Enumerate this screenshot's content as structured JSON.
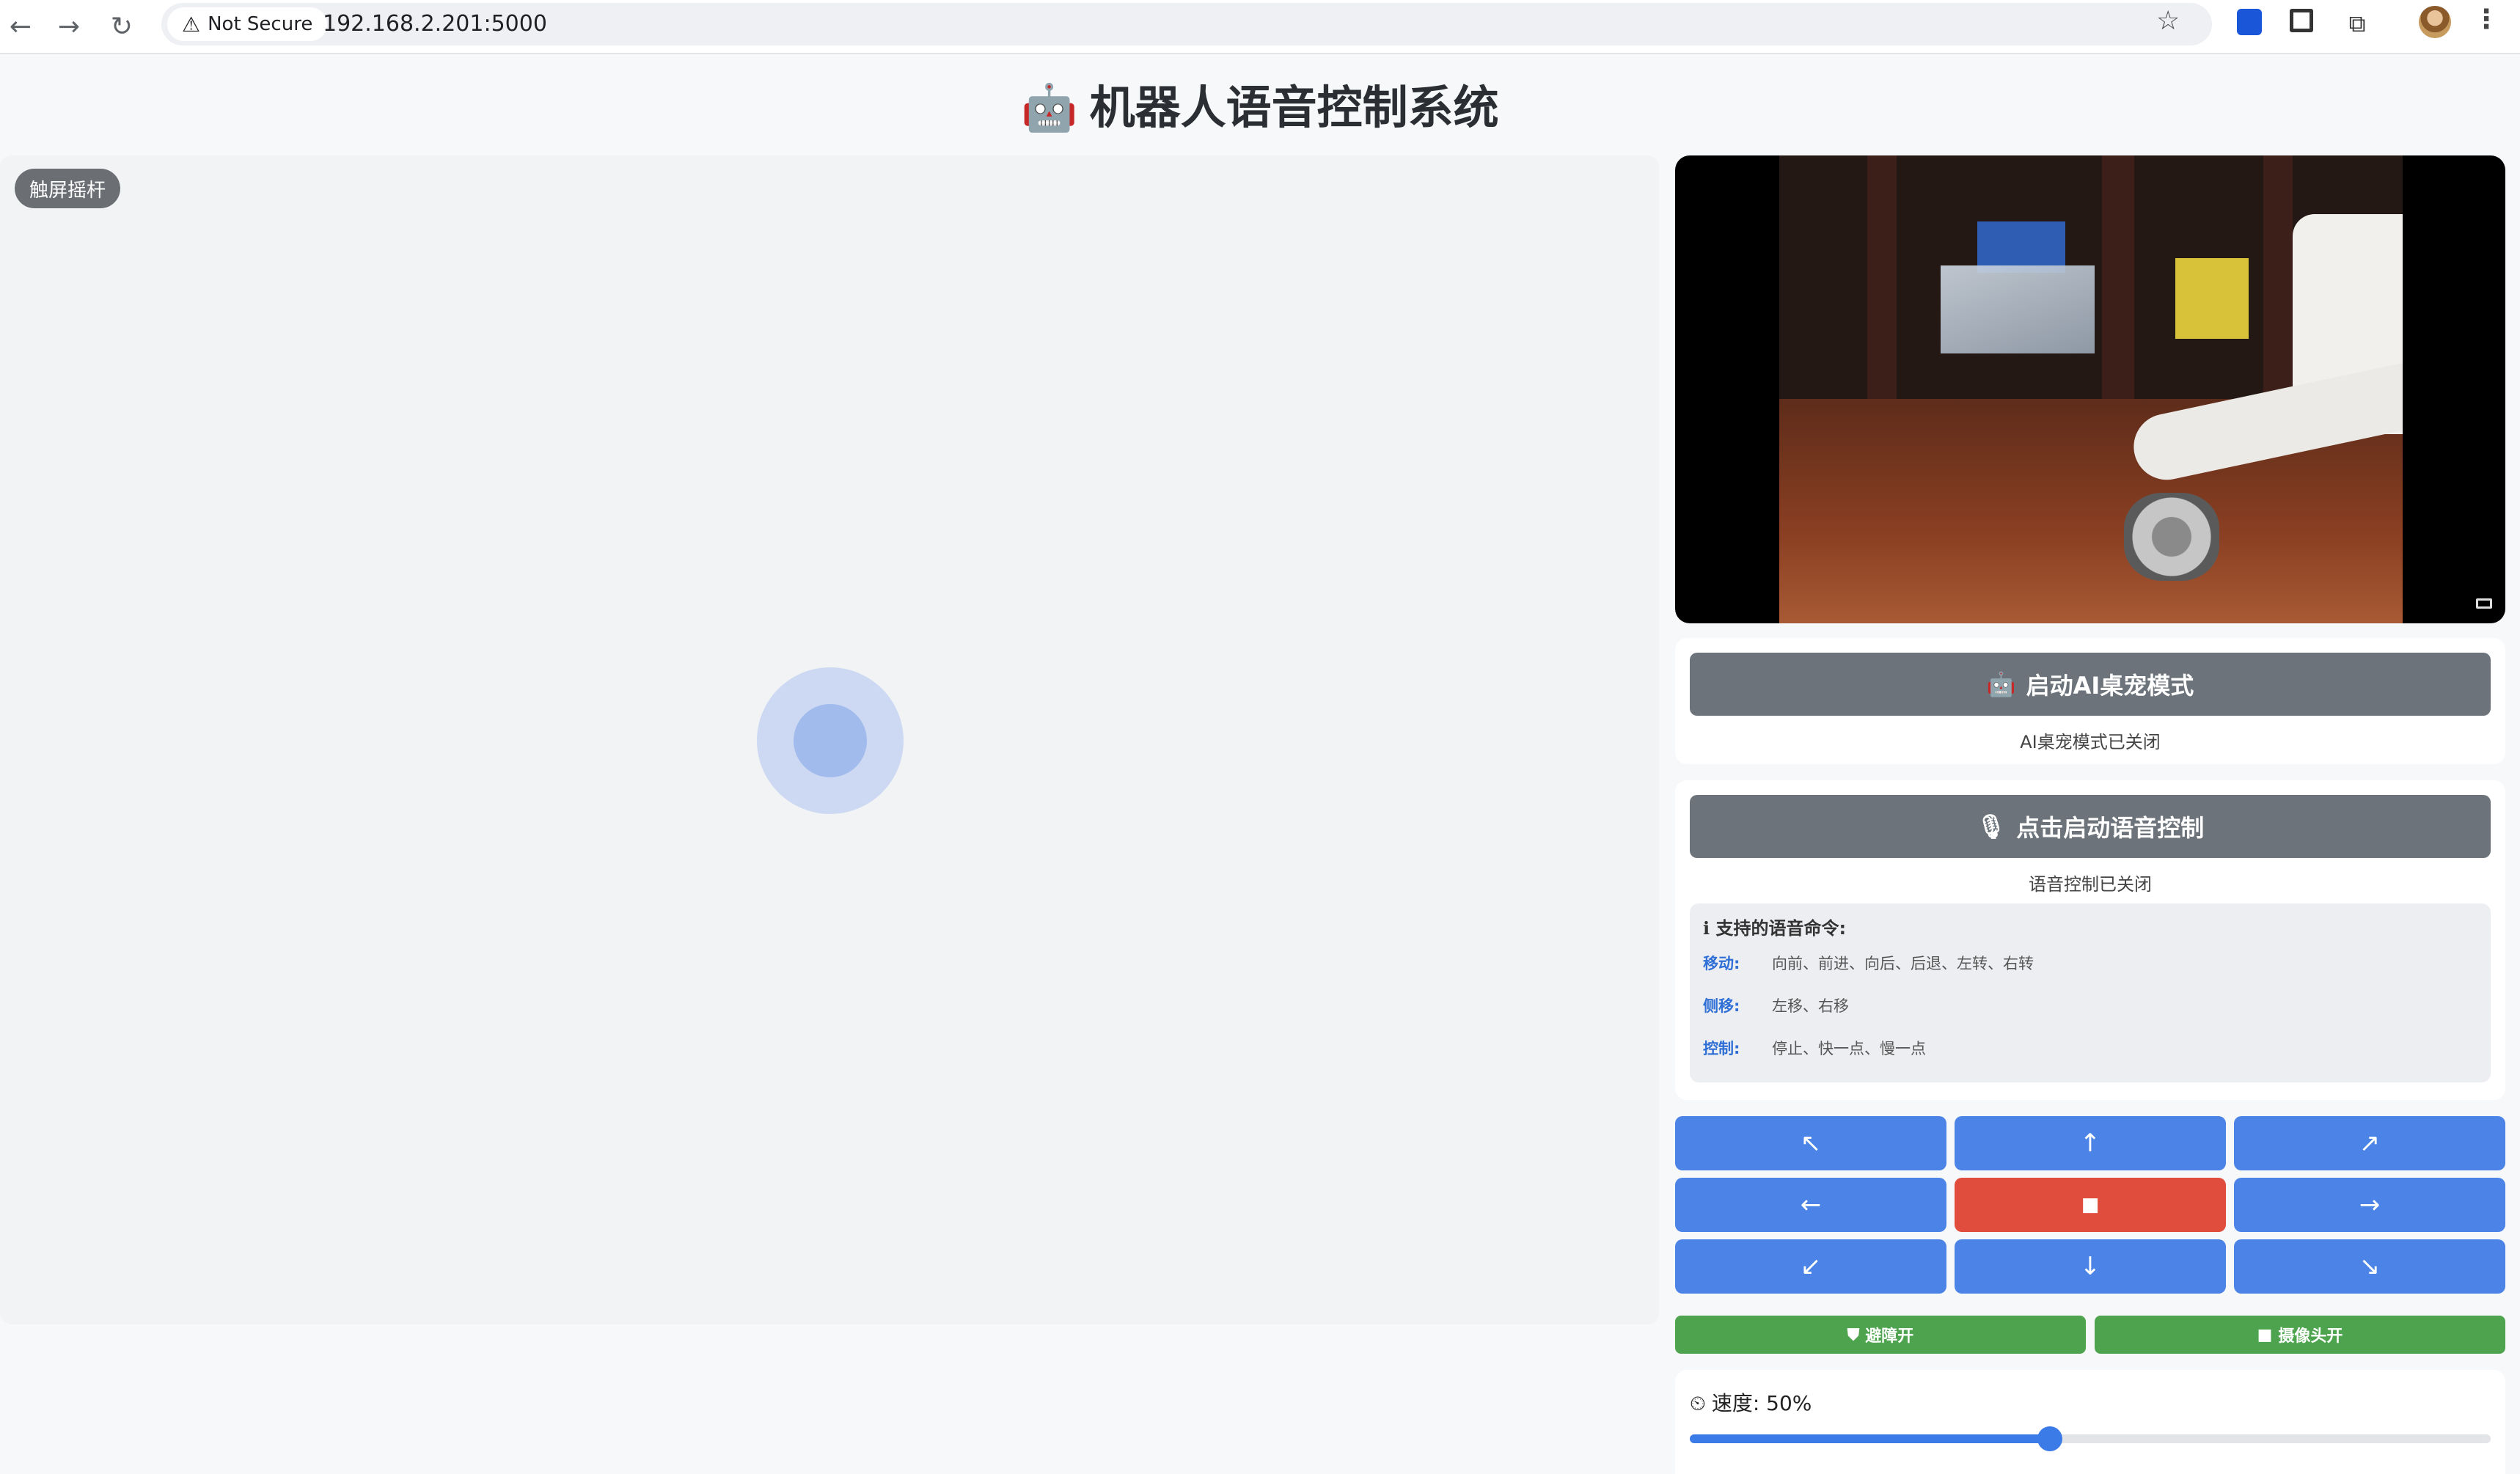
{
  "browser": {
    "security_label": "Not Secure",
    "url": "192.168.2.201:5000",
    "back_icon": "←",
    "forward_icon": "→",
    "reload_icon": "↻",
    "star_icon": "☆",
    "extensions_icon": "⧉",
    "menu_icon": "⋮"
  },
  "page": {
    "title_emoji": "🤖",
    "title": "机器人语音控制系统"
  },
  "joystick": {
    "badge": "触屏摇杆"
  },
  "ai_pet": {
    "icon": "🤖",
    "button_label": "启动AI桌宠模式",
    "status": "AI桌宠模式已关闭"
  },
  "voice": {
    "icon": "🎙",
    "button_label": "点击启动语音控制",
    "status": "语音控制已关闭",
    "commands_title": "支持的语音命令:",
    "commands_icon": "ℹ",
    "commands": [
      {
        "key": "移动:",
        "value": "向前、前进、向后、后退、左转、右转"
      },
      {
        "key": "侧移:",
        "value": "左移、右移"
      },
      {
        "key": "控制:",
        "value": "停止、快一点、慢一点"
      }
    ]
  },
  "dpad": {
    "up_left": "↖",
    "up": "↑",
    "up_right": "↗",
    "left": "←",
    "stop": "■",
    "right": "→",
    "down_left": "↙",
    "down": "↓",
    "down_right": "↘"
  },
  "toggles": {
    "obstacle_icon": "⛊",
    "obstacle_label": "避障开",
    "camera_icon": "■",
    "camera_label": "摄像头开"
  },
  "speed": {
    "icon": "⏲",
    "label": "速度: 50%",
    "value_percent": 45
  },
  "colors": {
    "primary_blue": "#4b84e6",
    "stop_red": "#e04d3c",
    "toggle_green": "#4ea44e",
    "disabled_gray": "#6c737a"
  }
}
